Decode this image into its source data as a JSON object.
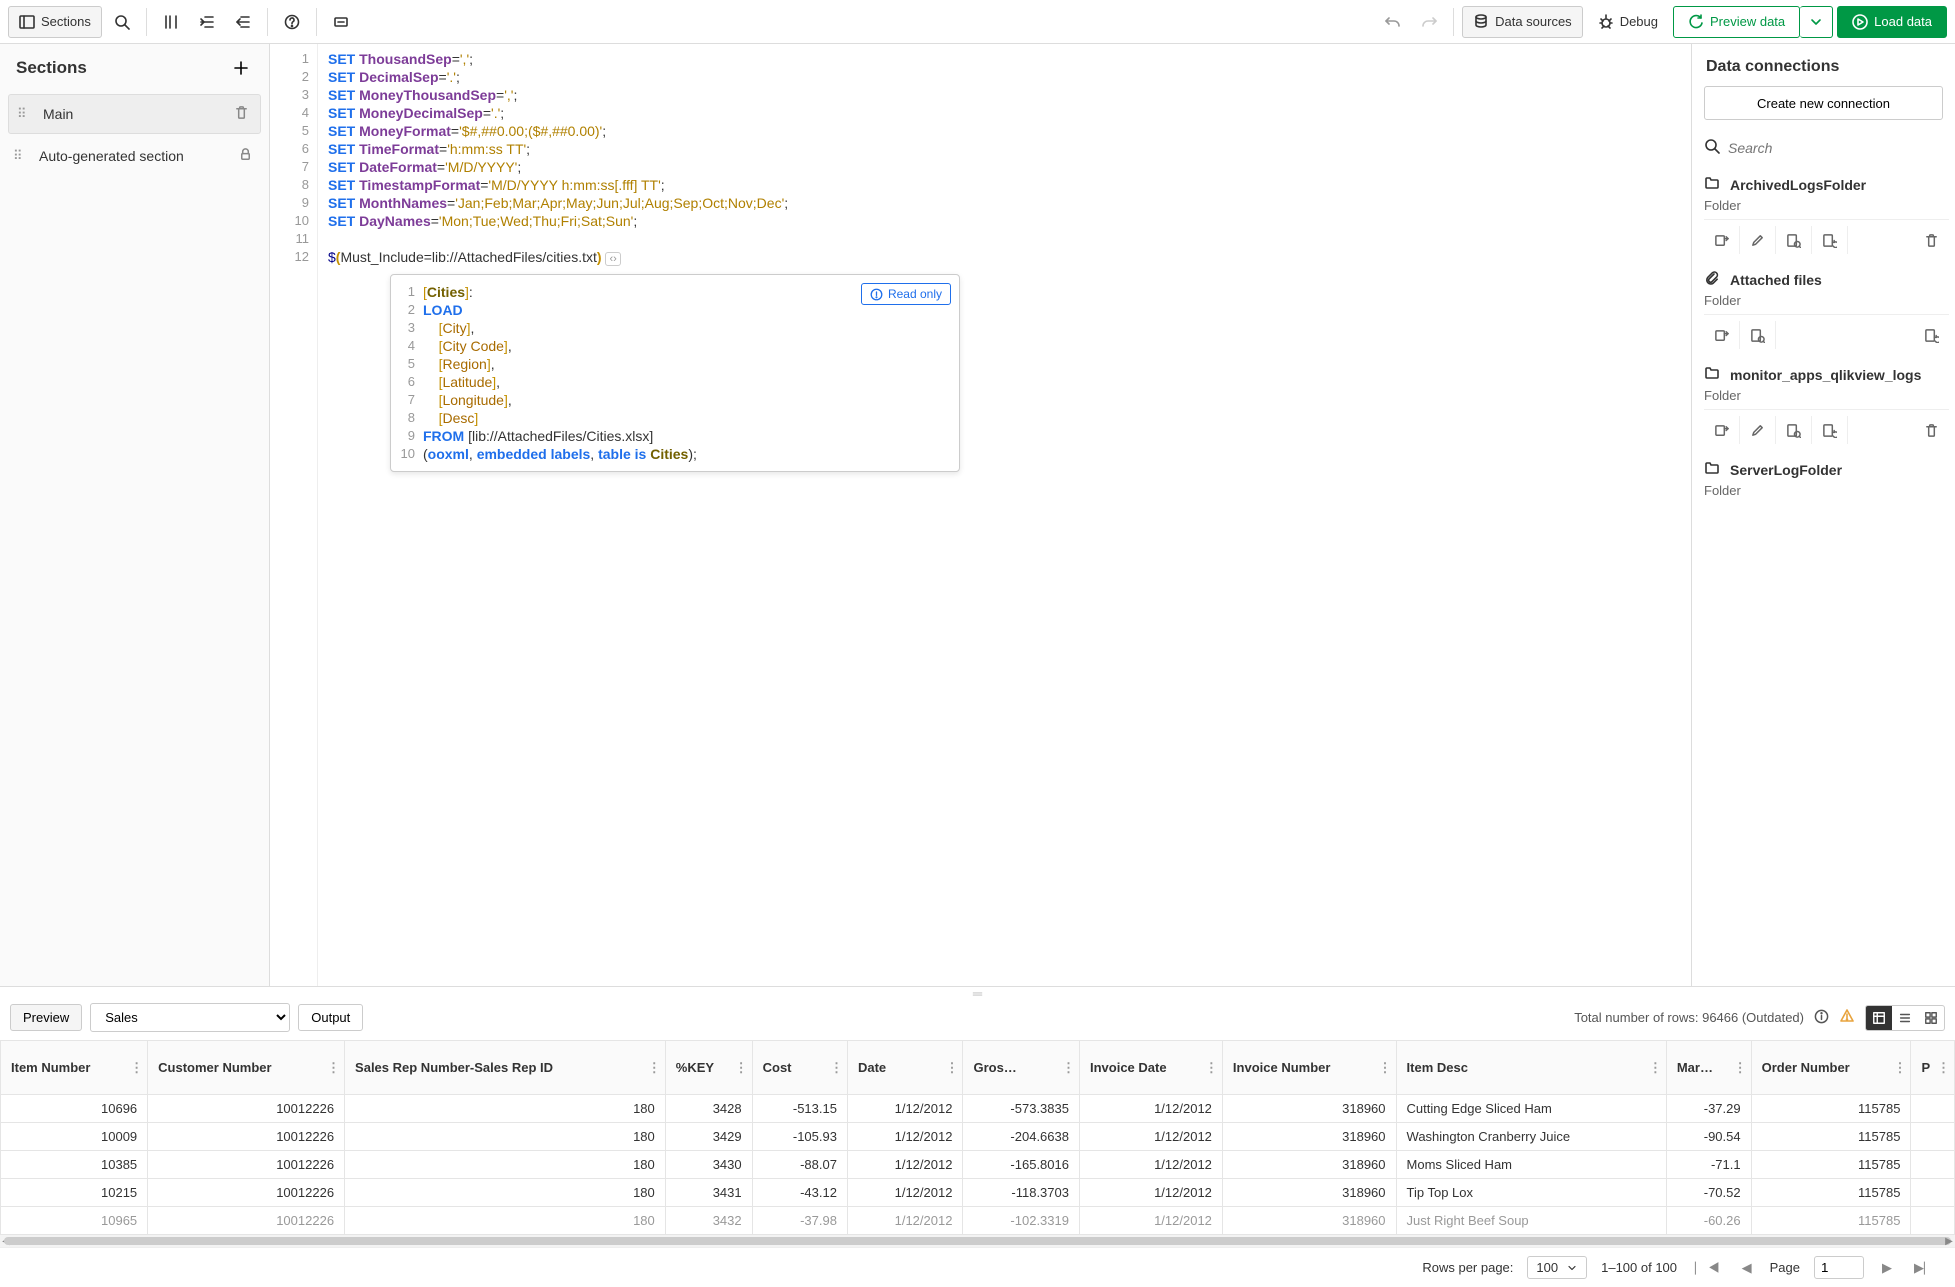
{
  "toolbar": {
    "sections": "Sections",
    "data_sources": "Data sources",
    "debug": "Debug",
    "preview_data": "Preview data",
    "load_data": "Load data"
  },
  "sections_panel": {
    "title": "Sections",
    "items": [
      {
        "label": "Main",
        "active": true,
        "trash": true,
        "lock": false
      },
      {
        "label": "Auto-generated section",
        "active": false,
        "trash": false,
        "lock": true
      }
    ]
  },
  "editor": {
    "readonly_badge": "Read only",
    "lines": 12,
    "code": [
      {
        "n": 1,
        "t": [
          [
            "kw-set",
            "SET "
          ],
          [
            "kw-var",
            "ThousandSep"
          ],
          [
            "punct",
            "="
          ],
          [
            "str",
            "','"
          ],
          [
            "punct",
            ";"
          ]
        ]
      },
      {
        "n": 2,
        "t": [
          [
            "kw-set",
            "SET "
          ],
          [
            "kw-var",
            "DecimalSep"
          ],
          [
            "punct",
            "="
          ],
          [
            "str",
            "'.'"
          ],
          [
            "punct",
            ";"
          ]
        ]
      },
      {
        "n": 3,
        "t": [
          [
            "kw-set",
            "SET "
          ],
          [
            "kw-var",
            "MoneyThousandSep"
          ],
          [
            "punct",
            "="
          ],
          [
            "str",
            "','"
          ],
          [
            "punct",
            ";"
          ]
        ]
      },
      {
        "n": 4,
        "t": [
          [
            "kw-set",
            "SET "
          ],
          [
            "kw-var",
            "MoneyDecimalSep"
          ],
          [
            "punct",
            "="
          ],
          [
            "str",
            "'.'"
          ],
          [
            "punct",
            ";"
          ]
        ]
      },
      {
        "n": 5,
        "t": [
          [
            "kw-set",
            "SET "
          ],
          [
            "kw-var",
            "MoneyFormat"
          ],
          [
            "punct",
            "="
          ],
          [
            "str",
            "'$#,##0.00;($#,##0.00)'"
          ],
          [
            "punct",
            ";"
          ]
        ]
      },
      {
        "n": 6,
        "t": [
          [
            "kw-set",
            "SET "
          ],
          [
            "kw-var",
            "TimeFormat"
          ],
          [
            "punct",
            "="
          ],
          [
            "str",
            "'h:mm:ss TT'"
          ],
          [
            "punct",
            ";"
          ]
        ]
      },
      {
        "n": 7,
        "t": [
          [
            "kw-set",
            "SET "
          ],
          [
            "kw-var",
            "DateFormat"
          ],
          [
            "punct",
            "="
          ],
          [
            "str",
            "'M/D/YYYY'"
          ],
          [
            "punct",
            ";"
          ]
        ]
      },
      {
        "n": 8,
        "t": [
          [
            "kw-set",
            "SET "
          ],
          [
            "kw-var",
            "TimestampFormat"
          ],
          [
            "punct",
            "="
          ],
          [
            "str",
            "'M/D/YYYY h:mm:ss[.fff] TT'"
          ],
          [
            "punct",
            ";"
          ]
        ]
      },
      {
        "n": 9,
        "t": [
          [
            "kw-set",
            "SET "
          ],
          [
            "kw-var",
            "MonthNames"
          ],
          [
            "punct",
            "="
          ],
          [
            "str",
            "'Jan;Feb;Mar;Apr;May;Jun;Jul;Aug;Sep;Oct;Nov;Dec'"
          ],
          [
            "punct",
            ";"
          ]
        ]
      },
      {
        "n": 10,
        "t": [
          [
            "kw-set",
            "SET "
          ],
          [
            "kw-var",
            "DayNames"
          ],
          [
            "punct",
            "="
          ],
          [
            "str",
            "'Mon;Tue;Wed;Thu;Fri;Sat;Sun'"
          ],
          [
            "punct",
            ";"
          ]
        ]
      },
      {
        "n": 11,
        "t": []
      },
      {
        "n": 12,
        "t": [
          [
            "dollar",
            "$"
          ],
          [
            "br-y",
            "("
          ],
          [
            "punct",
            "Must_Include=lib://AttachedFiles/cities.txt"
          ],
          [
            "br-y",
            ")"
          ]
        ]
      }
    ],
    "inset": [
      {
        "n": 1,
        "t": [
          [
            "br-o",
            "["
          ],
          [
            "tbl",
            "Cities"
          ],
          [
            "br-o",
            "]"
          ],
          [
            "punct",
            ":"
          ]
        ]
      },
      {
        "n": 2,
        "t": [
          [
            "blue-kw",
            "LOAD"
          ]
        ]
      },
      {
        "n": 3,
        "t": [
          [
            "punct",
            "    "
          ],
          [
            "br-o",
            "["
          ],
          [
            "iden",
            "City"
          ],
          [
            "br-o",
            "]"
          ],
          [
            "punct",
            ","
          ]
        ]
      },
      {
        "n": 4,
        "t": [
          [
            "punct",
            "    "
          ],
          [
            "br-o",
            "["
          ],
          [
            "iden",
            "City Code"
          ],
          [
            "br-o",
            "]"
          ],
          [
            "punct",
            ","
          ]
        ]
      },
      {
        "n": 5,
        "t": [
          [
            "punct",
            "    "
          ],
          [
            "br-o",
            "["
          ],
          [
            "iden",
            "Region"
          ],
          [
            "br-o",
            "]"
          ],
          [
            "punct",
            ","
          ]
        ]
      },
      {
        "n": 6,
        "t": [
          [
            "punct",
            "    "
          ],
          [
            "br-o",
            "["
          ],
          [
            "iden",
            "Latitude"
          ],
          [
            "br-o",
            "]"
          ],
          [
            "punct",
            ","
          ]
        ]
      },
      {
        "n": 7,
        "t": [
          [
            "punct",
            "    "
          ],
          [
            "br-o",
            "["
          ],
          [
            "iden",
            "Longitude"
          ],
          [
            "br-o",
            "]"
          ],
          [
            "punct",
            ","
          ]
        ]
      },
      {
        "n": 8,
        "t": [
          [
            "punct",
            "    "
          ],
          [
            "br-o",
            "["
          ],
          [
            "iden",
            "Desc"
          ],
          [
            "br-o",
            "]"
          ]
        ]
      },
      {
        "n": 9,
        "t": [
          [
            "blue-kw",
            "FROM"
          ],
          [
            "punct",
            " [lib://AttachedFiles/Cities.xlsx]"
          ]
        ]
      },
      {
        "n": 10,
        "t": [
          [
            "punct",
            "("
          ],
          [
            "blue-kw",
            "ooxml"
          ],
          [
            "punct",
            ", "
          ],
          [
            "blue-kw",
            "embedded labels"
          ],
          [
            "punct",
            ", "
          ],
          [
            "blue-kw",
            "table is"
          ],
          [
            "punct",
            " "
          ],
          [
            "tbl",
            "Cities"
          ],
          [
            "punct",
            ");"
          ]
        ]
      }
    ]
  },
  "connections": {
    "title": "Data connections",
    "create": "Create new connection",
    "search_placeholder": "Search",
    "items": [
      {
        "name": "ArchivedLogsFolder",
        "type": "Folder",
        "icon": "folder",
        "actions": [
          "insert",
          "edit",
          "select",
          "refresh",
          "delete"
        ]
      },
      {
        "name": "Attached files",
        "type": "Folder",
        "icon": "attach",
        "actions": [
          "insert",
          "select",
          "refresh"
        ]
      },
      {
        "name": "monitor_apps_qlikview_logs",
        "type": "Folder",
        "icon": "folder",
        "actions": [
          "insert",
          "edit",
          "select",
          "refresh",
          "delete"
        ]
      },
      {
        "name": "ServerLogFolder",
        "type": "Folder",
        "icon": "folder",
        "actions": []
      }
    ]
  },
  "preview": {
    "tab_preview": "Preview",
    "tab_output": "Output",
    "source": "Sales",
    "total_rows": "Total number of rows: 96466 (Outdated)",
    "columns": [
      "Item Number",
      "Customer Number",
      "Sales Rep Number-Sales Rep ID",
      "%KEY",
      "Cost",
      "Date",
      "Gros…",
      "Invoice Date",
      "Invoice Number",
      "Item Desc",
      "Mar…",
      "Order Number",
      "P"
    ],
    "rows": [
      [
        "10696",
        "10012226",
        "180",
        "3428",
        "-513.15",
        "1/12/2012",
        "-573.3835",
        "1/12/2012",
        "318960",
        "Cutting Edge Sliced Ham",
        "-37.29",
        "115785",
        ""
      ],
      [
        "10009",
        "10012226",
        "180",
        "3429",
        "-105.93",
        "1/12/2012",
        "-204.6638",
        "1/12/2012",
        "318960",
        "Washington Cranberry Juice",
        "-90.54",
        "115785",
        ""
      ],
      [
        "10385",
        "10012226",
        "180",
        "3430",
        "-88.07",
        "1/12/2012",
        "-165.8016",
        "1/12/2012",
        "318960",
        "Moms Sliced Ham",
        "-71.1",
        "115785",
        ""
      ],
      [
        "10215",
        "10012226",
        "180",
        "3431",
        "-43.12",
        "1/12/2012",
        "-118.3703",
        "1/12/2012",
        "318960",
        "Tip Top Lox",
        "-70.52",
        "115785",
        ""
      ],
      [
        "10965",
        "10012226",
        "180",
        "3432",
        "-37.98",
        "1/12/2012",
        "-102.3319",
        "1/12/2012",
        "318960",
        "Just Right Beef Soup",
        "-60.26",
        "115785",
        ""
      ]
    ],
    "rows_per_page_label": "Rows per page:",
    "rows_per_page": "100",
    "range": "1–100 of 100",
    "page_label": "Page",
    "page": "1"
  }
}
